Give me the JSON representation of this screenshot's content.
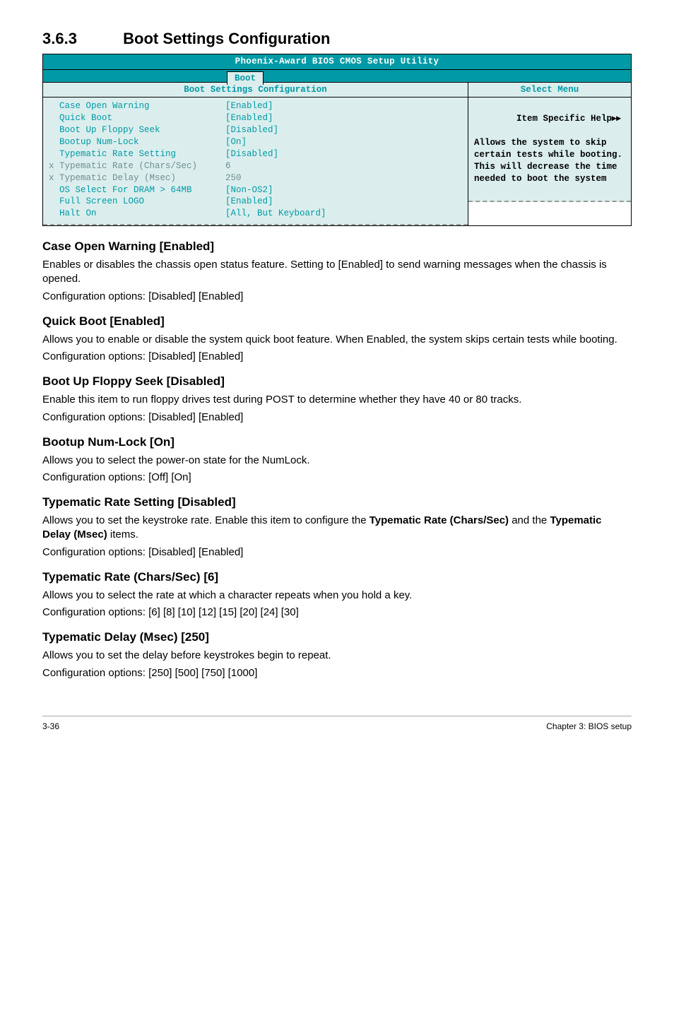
{
  "section": {
    "number": "3.6.3",
    "title": "Boot Settings Configuration"
  },
  "bios": {
    "topbar": "Phoenix-Award BIOS CMOS Setup Utility",
    "tab": "Boot",
    "left_header": "Boot Settings Configuration",
    "right_header": "Select Menu",
    "rows": [
      {
        "prefix": "  ",
        "label": "Case Open Warning",
        "value": "[Enabled]",
        "grey": false
      },
      {
        "prefix": "  ",
        "label": "Quick Boot",
        "value": "[Enabled]",
        "grey": false
      },
      {
        "prefix": "  ",
        "label": "Boot Up Floppy Seek",
        "value": "[Disabled]",
        "grey": false
      },
      {
        "prefix": "  ",
        "label": "Bootup Num-Lock",
        "value": "[On]",
        "grey": false
      },
      {
        "prefix": "  ",
        "label": "Typematic Rate Setting",
        "value": "[Disabled]",
        "grey": false
      },
      {
        "prefix": "x ",
        "label": "Typematic Rate (Chars/Sec)",
        "value": "6",
        "grey": true
      },
      {
        "prefix": "x ",
        "label": "Typematic Delay (Msec)",
        "value": "250",
        "grey": true
      },
      {
        "prefix": "  ",
        "label": "OS Select For DRAM > 64MB",
        "value": "[Non-OS2]",
        "grey": false
      },
      {
        "prefix": "  ",
        "label": "Full Screen LOGO",
        "value": "[Enabled]",
        "grey": false
      },
      {
        "prefix": "  ",
        "label": "Halt On",
        "value": "[All, But Keyboard]",
        "grey": false
      }
    ],
    "help_title": "Item Specific Help",
    "help_body": "Allows the system to skip certain tests while booting. This will decrease the time needed to boot the system"
  },
  "subsections": [
    {
      "heading": "Case Open Warning [Enabled]",
      "paras": [
        "Enables or disables the chassis open status feature. Setting to [Enabled] to send warning messages when the chassis is opened.",
        "Configuration options: [Disabled] [Enabled]"
      ]
    },
    {
      "heading": "Quick Boot [Enabled]",
      "paras": [
        "Allows you to enable or disable the system quick boot feature. When Enabled, the system skips certain tests while booting.",
        "Configuration options: [Disabled] [Enabled]"
      ]
    },
    {
      "heading": "Boot Up Floppy Seek [Disabled]",
      "paras": [
        "Enable this item to run floppy drives test during POST to determine whether they have 40 or 80 tracks.",
        "Configuration options: [Disabled] [Enabled]"
      ]
    },
    {
      "heading": "Bootup Num-Lock [On]",
      "paras": [
        "Allows you to select the power-on state for the NumLock.",
        "Configuration options: [Off] [On]"
      ]
    },
    {
      "heading": "Typematic Rate Setting [Disabled]",
      "paras": [
        "Allows you to set the keystroke rate. Enable this item to configure the <b>Typematic Rate (Chars/Sec)</b> and the <b>Typematic Delay (Msec)</b> items.",
        "Configuration options: [Disabled] [Enabled]"
      ]
    },
    {
      "heading": "Typematic Rate (Chars/Sec) [6]",
      "paras": [
        "Allows you to select the rate at which a character repeats when you hold a key.",
        "Configuration options: [6] [8] [10] [12] [15] [20] [24] [30]"
      ]
    },
    {
      "heading": "Typematic Delay (Msec) [250]",
      "paras": [
        "Allows you to set the delay before keystrokes begin to repeat.",
        "Configuration options: [250] [500] [750] [1000]"
      ]
    }
  ],
  "footer": {
    "left": "3-36",
    "right": "Chapter 3: BIOS setup"
  }
}
